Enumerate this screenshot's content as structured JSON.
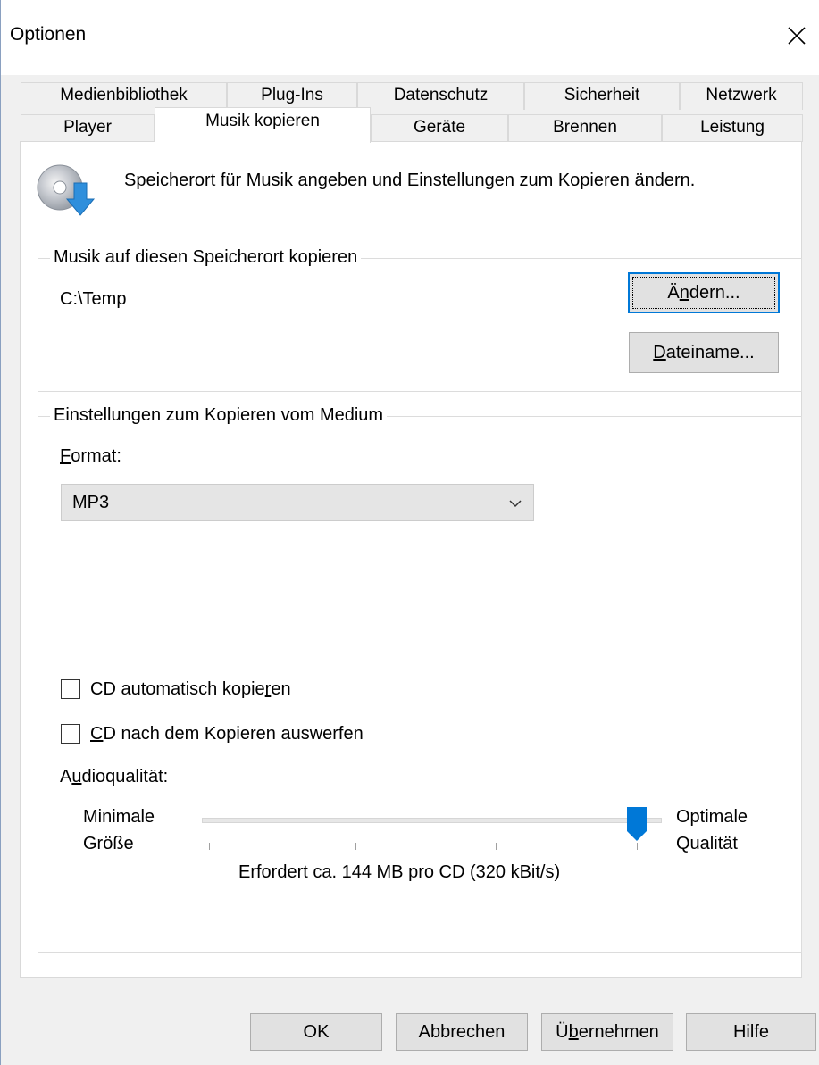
{
  "window": {
    "title": "Optionen",
    "icons": {
      "close": "close-icon",
      "header": "cd-rip-icon",
      "dropdown": "chevron-down-icon"
    },
    "accent_color": "#0078d7"
  },
  "tabs": {
    "top_row": [
      "Medienbibliothek",
      "Plug-Ins",
      "Datenschutz",
      "Sicherheit",
      "Netzwerk"
    ],
    "bottom_row": [
      "Player",
      "Musik kopieren",
      "Geräte",
      "Brennen",
      "Leistung"
    ],
    "selected": "Musik kopieren"
  },
  "intro": {
    "text": "Speicherort für Musik angeben und Einstellungen zum Kopieren ändern."
  },
  "location_group": {
    "legend": "Musik auf diesen Speicherort kopieren",
    "path": "C:\\Temp",
    "change_button": {
      "pre": "Ä",
      "mnemonic": "n",
      "post": "dern..."
    },
    "filename_button": {
      "pre": "",
      "mnemonic": "D",
      "post": "ateiname..."
    }
  },
  "rip_settings": {
    "legend": "Einstellungen zum Kopieren vom Medium",
    "format_label": {
      "mnemonic": "F",
      "rest": "ormat:"
    },
    "format_value": "MP3",
    "auto_rip": {
      "pre": "CD automatisch kopie",
      "mnemonic": "r",
      "post": "en",
      "checked": false
    },
    "eject": {
      "pre": "",
      "mnemonic": "C",
      "post": "D nach dem Kopieren auswerfen",
      "checked": false
    },
    "audio_quality_label": {
      "pre": "A",
      "mnemonic": "u",
      "post": "dioqualität:"
    },
    "min_label": [
      "Minimale",
      "Größe"
    ],
    "max_label": [
      "Optimale",
      "Qualität"
    ],
    "quality_level": 1.0,
    "required_text": "Erfordert ca. 144 MB pro CD (320 kBit/s)"
  },
  "footer": {
    "ok": "OK",
    "cancel": "Abbrechen",
    "apply": {
      "pre": "Ü",
      "mnemonic": "b",
      "post": "ernehmen"
    },
    "help": "Hilfe"
  }
}
